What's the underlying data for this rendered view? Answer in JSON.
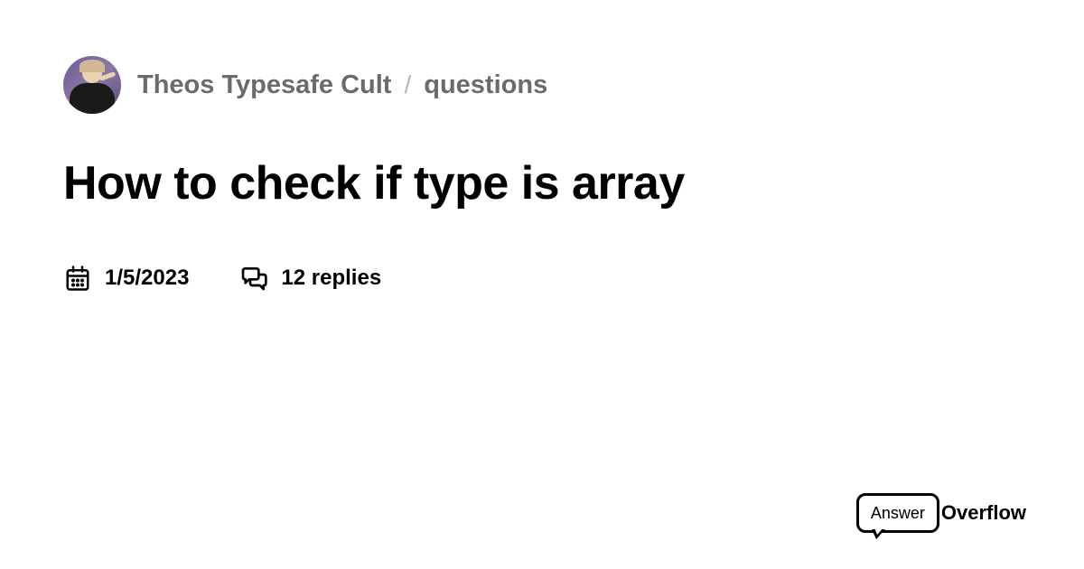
{
  "breadcrumb": {
    "community": "Theos Typesafe Cult",
    "separator": "/",
    "channel": "questions"
  },
  "title": "How to check if type is array",
  "meta": {
    "date": "1/5/2023",
    "replies": "12 replies"
  },
  "logo": {
    "text_a": "Answer",
    "text_b": "Overflow"
  }
}
